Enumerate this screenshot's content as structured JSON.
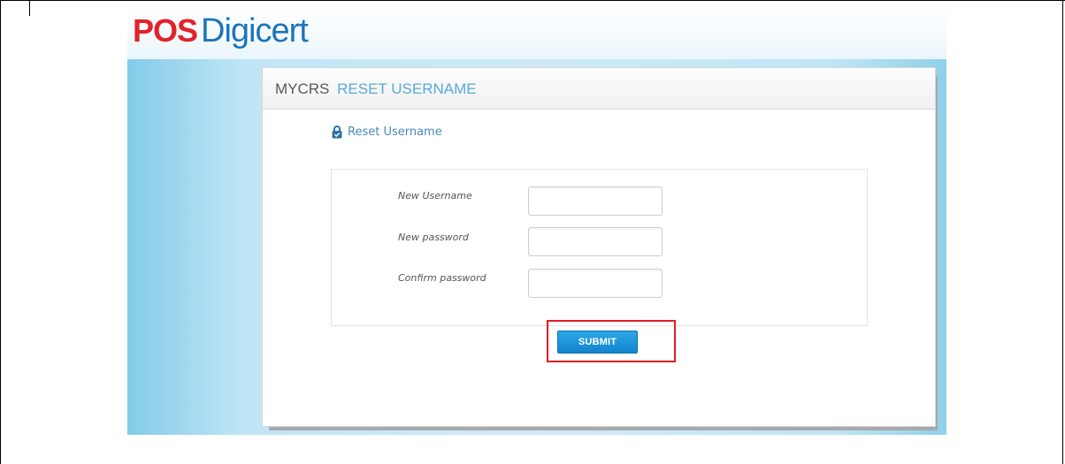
{
  "brand": {
    "logo_left": "POS",
    "logo_right": "Digicert",
    "logo_color_red": "#e2232a",
    "logo_color_blue": "#1b75bb"
  },
  "panel": {
    "title_main": "MYCRS",
    "title_sub": "RESET USERNAME"
  },
  "section": {
    "icon": "lock-icon",
    "title": "Reset Username"
  },
  "form": {
    "fields": [
      {
        "label": "New Username",
        "value": ""
      },
      {
        "label": "New password",
        "value": ""
      },
      {
        "label": "Confirm password",
        "value": ""
      }
    ],
    "submit_label": "SUBMIT"
  },
  "colors": {
    "accent": "#1b8fd8",
    "highlight": "#e31c23"
  }
}
